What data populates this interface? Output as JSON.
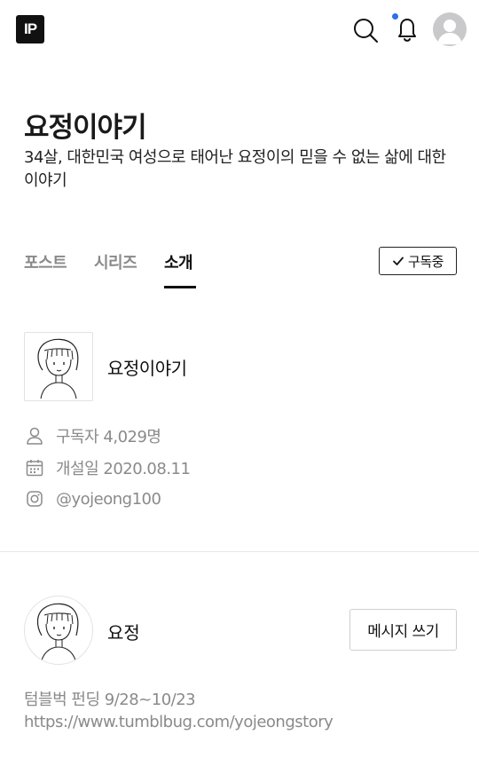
{
  "header": {
    "logo_text": "IP",
    "icons": [
      "search-icon",
      "bell-icon",
      "avatar"
    ],
    "notification_dot_color": "#2f6fe8"
  },
  "channel": {
    "title": "요정이야기",
    "description": "34살, 대한민국 여성으로 태어난 요정이의 믿을 수 없는 삶에 대한 이야기"
  },
  "tabs": [
    {
      "label": "포스트",
      "active": false
    },
    {
      "label": "시리즈",
      "active": false
    },
    {
      "label": "소개",
      "active": true
    }
  ],
  "subscribe_button": {
    "label": "구독중",
    "icon": "check-icon"
  },
  "profile": {
    "name": "요정이야기",
    "info": [
      {
        "icon": "user-icon",
        "text": "구독자 4,029명"
      },
      {
        "icon": "calendar-icon",
        "text": "개설일 2020.08.11"
      },
      {
        "icon": "instagram-icon",
        "text": "@yojeong100"
      }
    ]
  },
  "author": {
    "name": "요정",
    "message_button": "메시지 쓰기",
    "bio_line1": "텀블벅 펀딩 9/28~10/23",
    "bio_line2": "https://www.tumblbug.com/yojeongstory"
  }
}
